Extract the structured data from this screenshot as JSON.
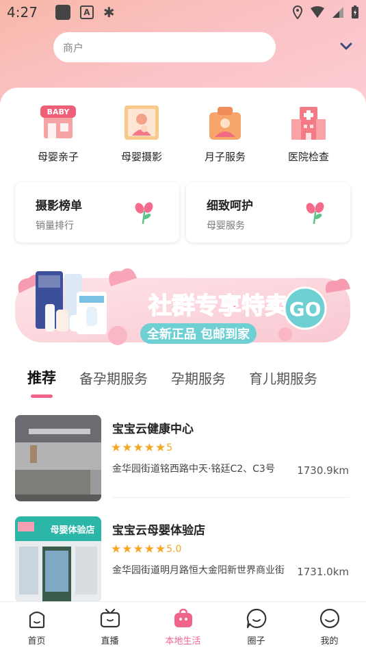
{
  "status_bar": {
    "time": "4:27"
  },
  "search": {
    "placeholder": "商户"
  },
  "categories": [
    {
      "label": "母婴亲子",
      "icon": "baby-store-icon"
    },
    {
      "label": "母婴摄影",
      "icon": "mother-photo-icon"
    },
    {
      "label": "月子服务",
      "icon": "maternity-care-icon"
    },
    {
      "label": "医院检查",
      "icon": "hospital-icon"
    }
  ],
  "promos": [
    {
      "title": "摄影榜单",
      "subtitle": "销量排行",
      "icon": "flower-icon"
    },
    {
      "title": "细致呵护",
      "subtitle": "母婴服务",
      "icon": "flower-icon"
    }
  ],
  "banner": {
    "headline": "社群专享特卖",
    "go_label": "GO",
    "tagline": "全新正品 包邮到家",
    "colors": {
      "pink": "#f06b8c",
      "teal": "#6fd0d4"
    }
  },
  "tabs": [
    {
      "label": "推荐",
      "active": true
    },
    {
      "label": "备孕期服务",
      "active": false
    },
    {
      "label": "孕期服务",
      "active": false
    },
    {
      "label": "育儿期服务",
      "active": false
    }
  ],
  "stores": [
    {
      "name": "宝宝云健康中心",
      "rating": "5",
      "address": "金华园街道铭西路中天·铭廷C2、C3号",
      "distance": "1730.9km"
    },
    {
      "name": "宝宝云母婴体验店",
      "rating": "5.0",
      "address": "金华园街道明月路恒大金阳新世界商业街",
      "distance": "1731.0km",
      "sign_text": "母婴体验店"
    }
  ],
  "bottom_nav": [
    {
      "label": "首页",
      "icon": "home-icon",
      "active": false
    },
    {
      "label": "直播",
      "icon": "tv-icon",
      "active": false
    },
    {
      "label": "本地生活",
      "icon": "local-life-icon",
      "active": true
    },
    {
      "label": "圈子",
      "icon": "chat-circle-icon",
      "active": false
    },
    {
      "label": "我的",
      "icon": "profile-icon",
      "active": false
    }
  ],
  "colors": {
    "accent": "#f0648c",
    "star": "#f5a623"
  }
}
